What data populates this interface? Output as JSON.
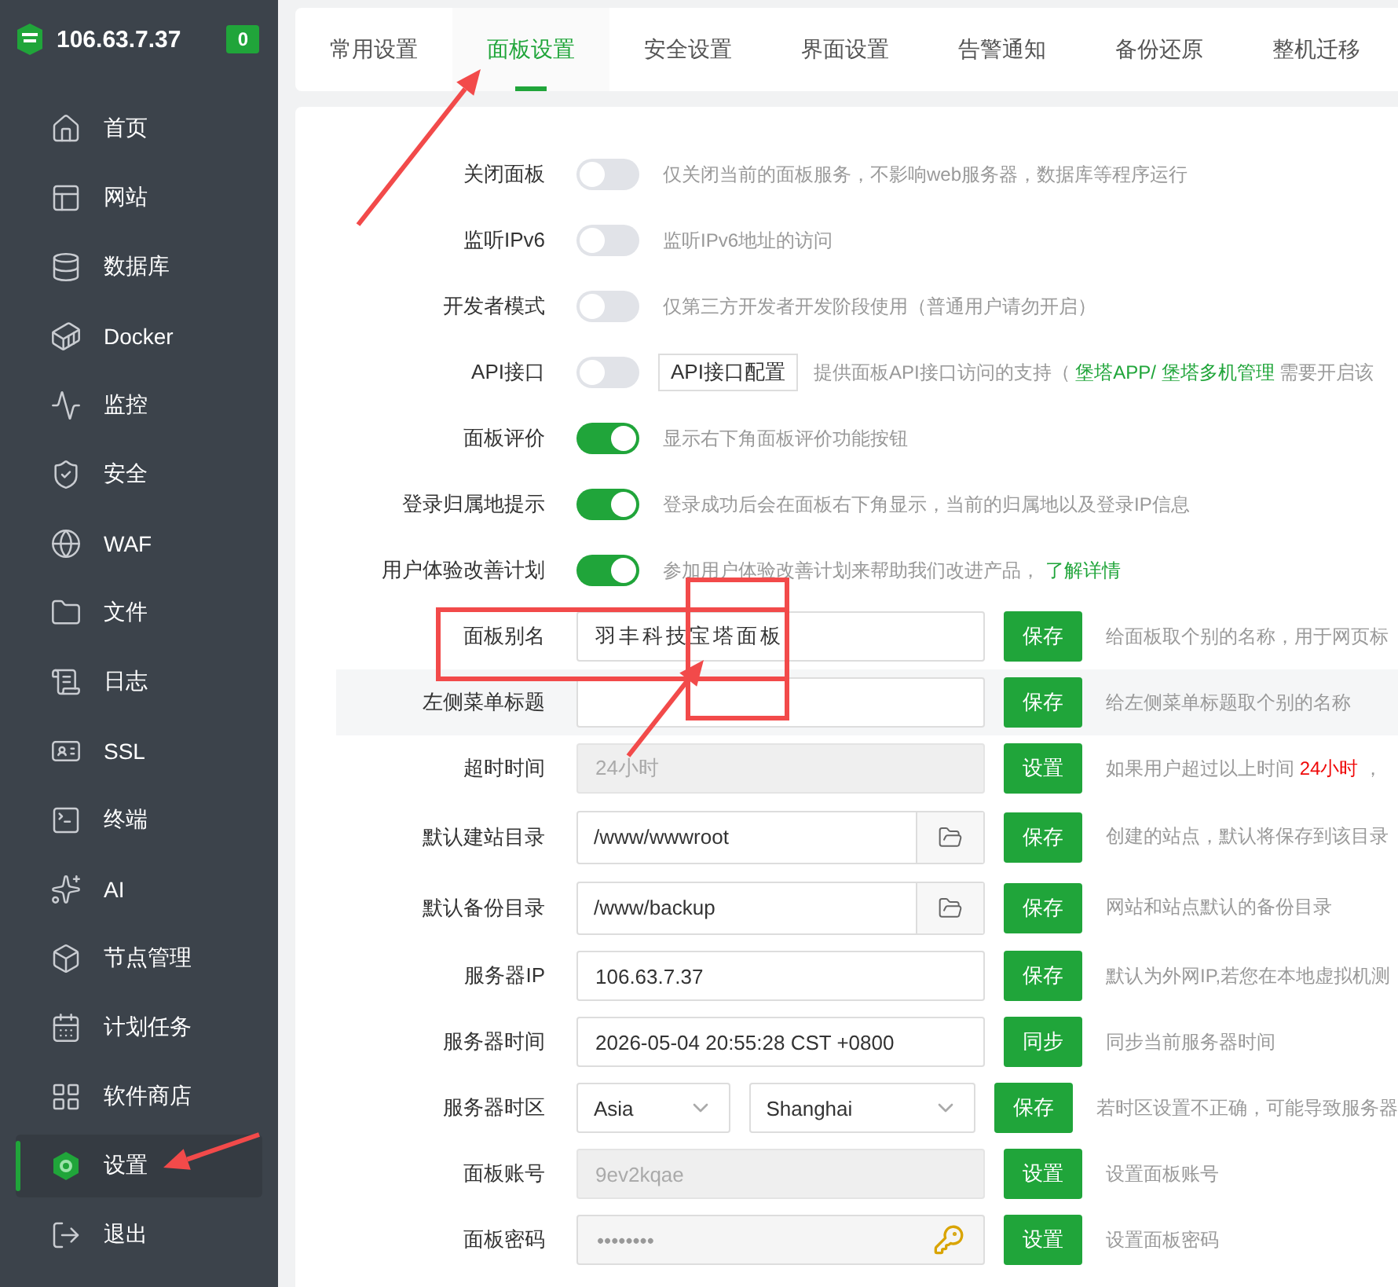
{
  "header": {
    "host": "106.63.7.37",
    "badge": "0"
  },
  "sidebar": {
    "items": [
      {
        "label": "首页",
        "selected": false
      },
      {
        "label": "网站",
        "selected": false
      },
      {
        "label": "数据库",
        "selected": false
      },
      {
        "label": "Docker",
        "selected": false
      },
      {
        "label": "监控",
        "selected": false
      },
      {
        "label": "安全",
        "selected": false
      },
      {
        "label": "WAF",
        "selected": false
      },
      {
        "label": "文件",
        "selected": false
      },
      {
        "label": "日志",
        "selected": false
      },
      {
        "label": "SSL",
        "selected": false
      },
      {
        "label": "终端",
        "selected": false
      },
      {
        "label": "AI",
        "selected": false
      },
      {
        "label": "节点管理",
        "selected": false
      },
      {
        "label": "计划任务",
        "selected": false
      },
      {
        "label": "软件商店",
        "selected": false
      },
      {
        "label": "设置",
        "selected": true
      },
      {
        "label": "退出",
        "selected": false
      }
    ]
  },
  "tabs": [
    {
      "label": "常用设置",
      "selected": false
    },
    {
      "label": "面板设置",
      "selected": true
    },
    {
      "label": "安全设置",
      "selected": false
    },
    {
      "label": "界面设置",
      "selected": false
    },
    {
      "label": "告警通知",
      "selected": false
    },
    {
      "label": "备份还原",
      "selected": false
    },
    {
      "label": "整机迁移",
      "selected": false
    }
  ],
  "rows": [
    {
      "kind": "toggle",
      "label": "关闭面板",
      "on": false,
      "desc": [
        {
          "kind": "text",
          "text": "仅关闭当前的面板服务，不影响web服务器，数据库等程序运行"
        }
      ]
    },
    {
      "kind": "toggle",
      "label": "监听IPv6",
      "on": false,
      "desc": [
        {
          "kind": "text",
          "text": "监听IPv6地址的访问"
        }
      ]
    },
    {
      "kind": "toggle",
      "label": "开发者模式",
      "on": false,
      "desc": [
        {
          "kind": "text",
          "text": "仅第三方开发者开发阶段使用（普通用户请勿开启）"
        }
      ]
    },
    {
      "kind": "toggle",
      "label": "API接口",
      "on": false,
      "button": "API接口配置",
      "desc": [
        {
          "kind": "text",
          "text": "提供面板API接口访问的支持（"
        },
        {
          "kind": "link",
          "text": "堡塔APP/"
        },
        {
          "kind": "link",
          "text": "堡塔多机管理"
        },
        {
          "kind": "text",
          "text": "需要开启该"
        }
      ]
    },
    {
      "kind": "toggle",
      "label": "面板评价",
      "on": true,
      "desc": [
        {
          "kind": "text",
          "text": "显示右下角面板评价功能按钮"
        }
      ]
    },
    {
      "kind": "toggle",
      "label": "登录归属地提示",
      "on": true,
      "desc": [
        {
          "kind": "text",
          "text": "登录成功后会在面板右下角显示，当前的归属地以及登录IP信息"
        }
      ]
    },
    {
      "kind": "toggle",
      "label": "用户体验改善计划",
      "on": true,
      "desc": [
        {
          "kind": "text",
          "text": "参加用户体验改善计划来帮助我们改进产品，"
        },
        {
          "kind": "link",
          "text": "了解详情"
        }
      ]
    },
    {
      "kind": "input",
      "label": "面板别名",
      "value": "羽丰科技宝塔面板",
      "disabled": false,
      "button": "保存",
      "desc": [
        {
          "kind": "text",
          "text": "给面板取个别的名称，用于网页标"
        }
      ]
    },
    {
      "kind": "input",
      "label": "左侧菜单标题",
      "value": "",
      "disabled": false,
      "highlighted": true,
      "button": "保存",
      "desc": [
        {
          "kind": "text",
          "text": "给左侧菜单标题取个别的名称"
        }
      ]
    },
    {
      "kind": "input",
      "label": "超时时间",
      "value": "24小时",
      "disabled": true,
      "button": "设置",
      "desc": [
        {
          "kind": "text",
          "text": "如果用户超过以上时间"
        },
        {
          "kind": "alert",
          "text": "24小时"
        },
        {
          "kind": "text",
          "text": "，"
        }
      ]
    },
    {
      "kind": "path",
      "label": "默认建站目录",
      "value": "/www/wwwroot",
      "button": "保存",
      "desc": [
        {
          "kind": "text",
          "text": "创建的站点，默认将保存到该目录"
        }
      ]
    },
    {
      "kind": "path",
      "label": "默认备份目录",
      "value": "/www/backup",
      "button": "保存",
      "desc": [
        {
          "kind": "text",
          "text": "网站和站点默认的备份目录"
        }
      ]
    },
    {
      "kind": "input",
      "label": "服务器IP",
      "value": "106.63.7.37",
      "disabled": false,
      "button": "保存",
      "desc": [
        {
          "kind": "text",
          "text": "默认为外网IP,若您在本地虚拟机测"
        }
      ]
    },
    {
      "kind": "input",
      "label": "服务器时间",
      "value": "2026-05-04 20:55:28 CST +0800",
      "disabled": false,
      "button": "同步",
      "desc": [
        {
          "kind": "text",
          "text": "同步当前服务器时间"
        }
      ]
    },
    {
      "kind": "select",
      "label": "服务器时区",
      "region": "Asia",
      "city": "Shanghai",
      "button": "保存",
      "desc": [
        {
          "kind": "text",
          "text": "若时区设置不正确，可能导致服务器"
        }
      ]
    },
    {
      "kind": "input",
      "label": "面板账号",
      "value": "9ev2kqae",
      "disabled": true,
      "button": "设置",
      "desc": [
        {
          "kind": "text",
          "text": "设置面板账号"
        }
      ]
    },
    {
      "kind": "password",
      "label": "面板密码",
      "value": "••••••••",
      "button": "设置",
      "desc": [
        {
          "kind": "text",
          "text": "设置面板密码"
        }
      ]
    }
  ]
}
